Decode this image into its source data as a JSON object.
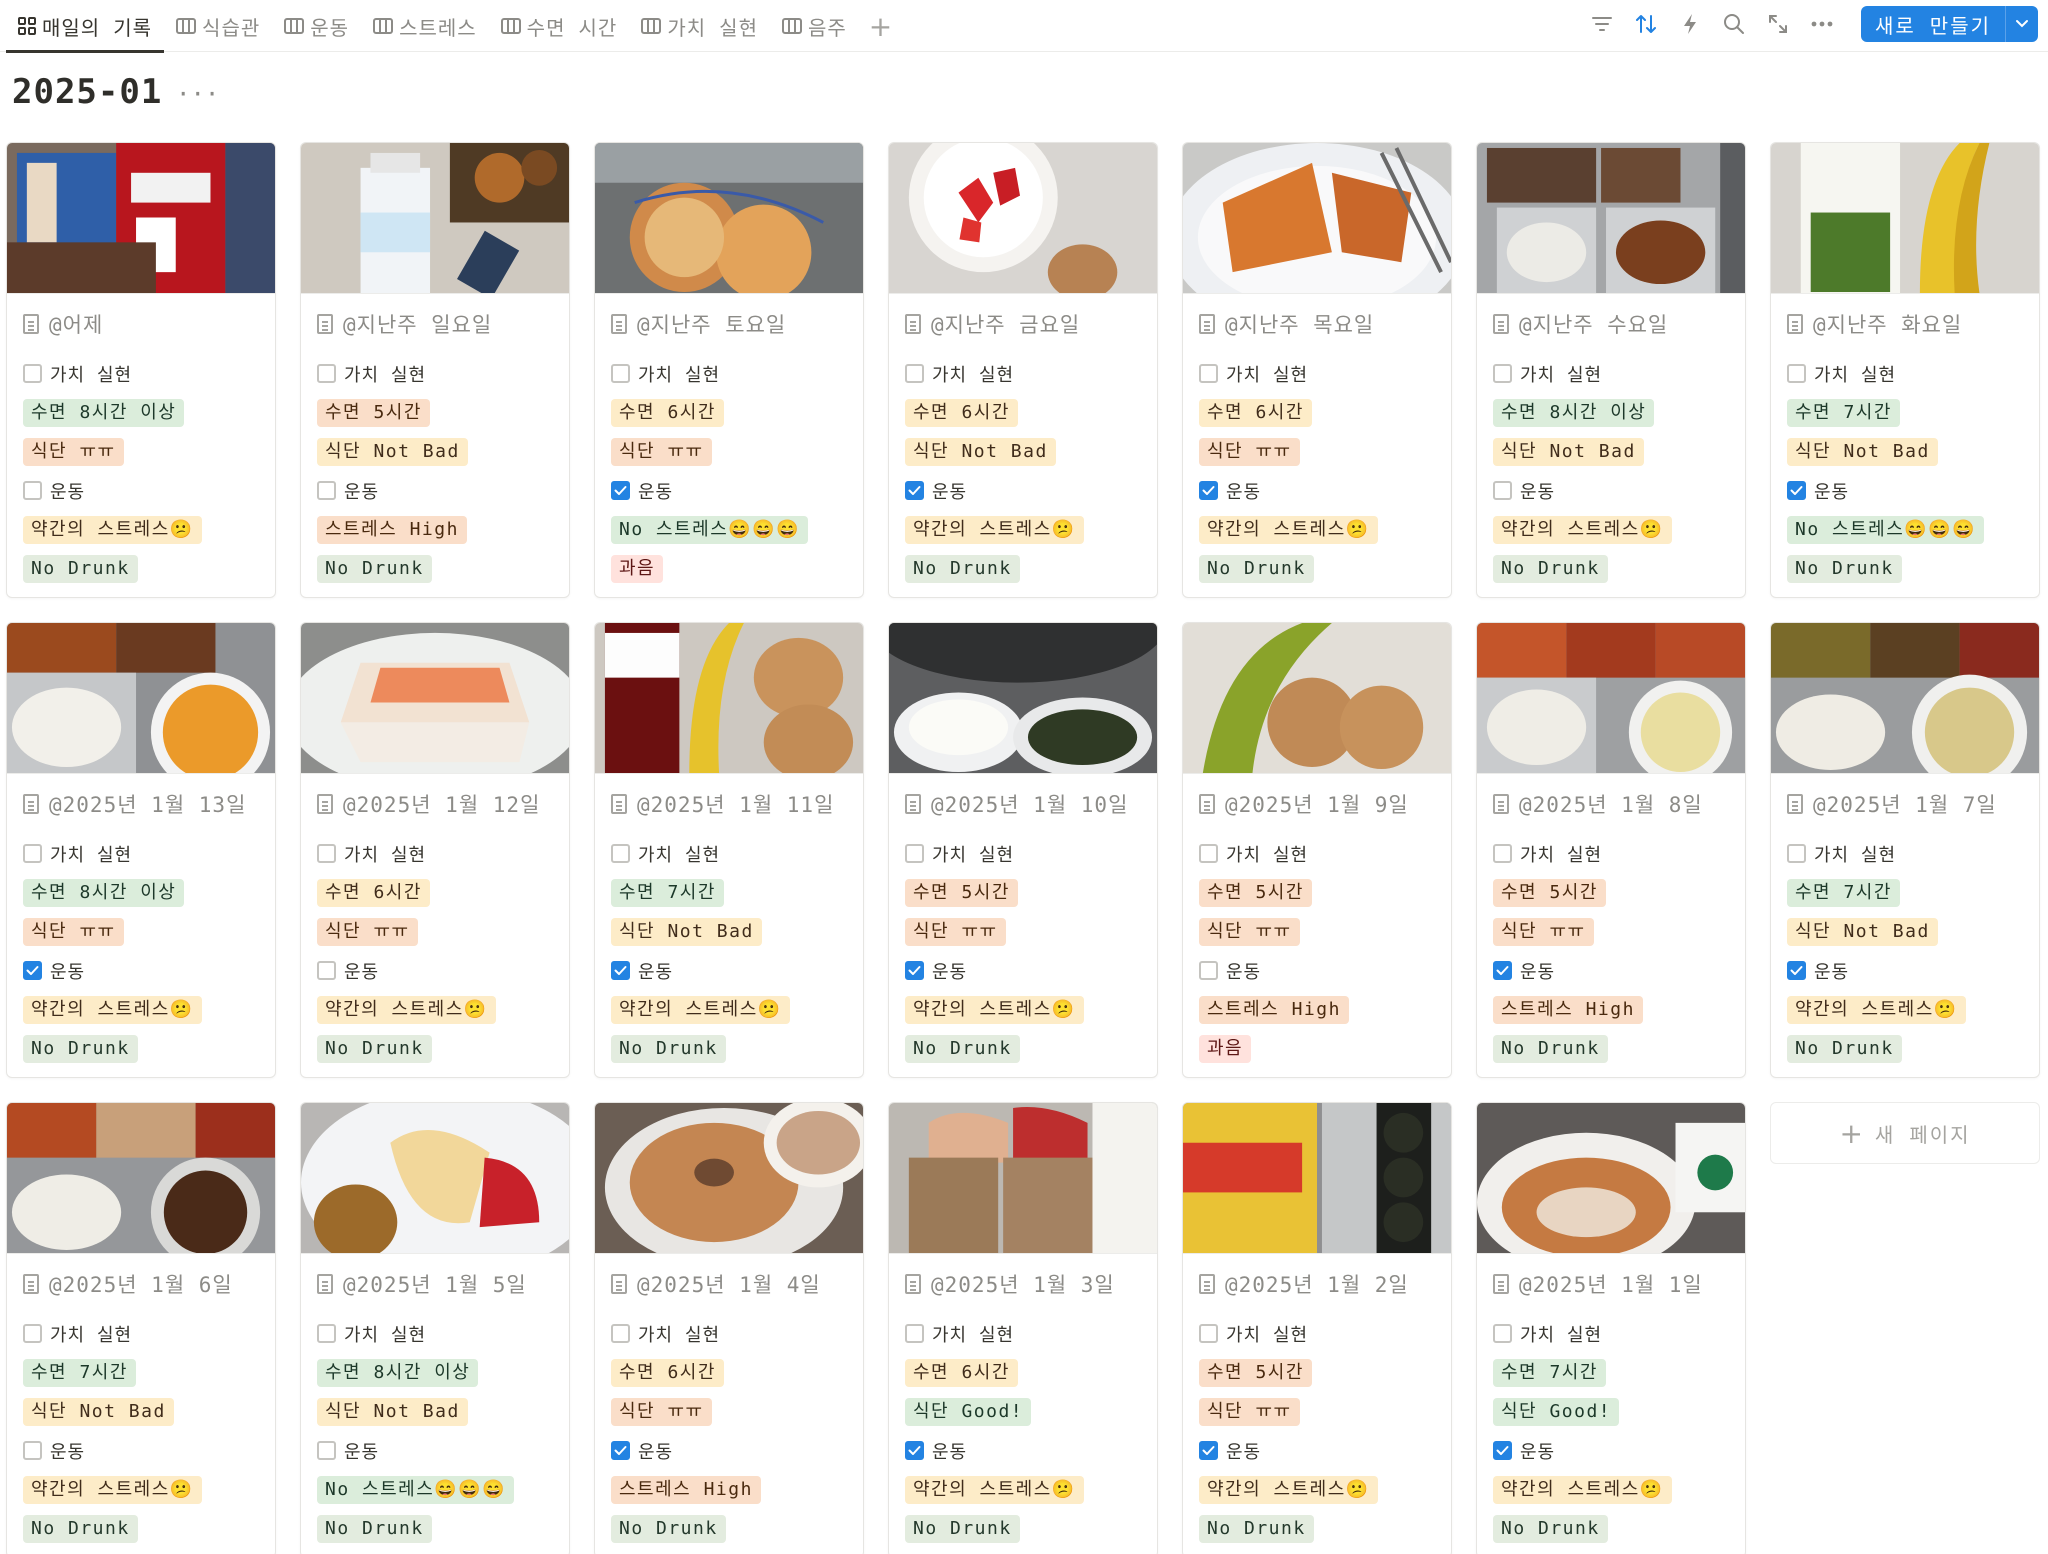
{
  "tabs": [
    {
      "label": "매일의 기록",
      "icon": "gallery-icon",
      "active": true
    },
    {
      "label": "식습관",
      "icon": "table-icon"
    },
    {
      "label": "운동",
      "icon": "table-icon"
    },
    {
      "label": "스트레스",
      "icon": "table-icon"
    },
    {
      "label": "수면 시간",
      "icon": "table-icon"
    },
    {
      "label": "가치 실현",
      "icon": "table-icon"
    },
    {
      "label": "음주",
      "icon": "table-icon"
    }
  ],
  "toolbar": {
    "add_tab": "+",
    "icons": [
      "filter-icon",
      "sort-icon",
      "automation-icon",
      "search-icon",
      "expand-icon",
      "more-icon"
    ],
    "new_button": "새로 만들기"
  },
  "page": {
    "title": "2025-01",
    "more": "···"
  },
  "colors": {
    "accent": "#2383e2"
  },
  "cards": [
    {
      "title": "@어제",
      "thumb": "dessert",
      "value": "가치 실현",
      "value_checked": false,
      "sleep": "수면 8시간 이상",
      "sleep_c": "green",
      "diet": "식단 ㅠㅠ",
      "diet_c": "orange",
      "exercise": "운동",
      "exercise_checked": false,
      "stress": "약간의 스트레스😕",
      "stress_c": "yellow",
      "drink": "No Drunk",
      "drink_c": "sage"
    },
    {
      "title": "@지난주 일요일",
      "thumb": "protein",
      "value": "가치 실현",
      "value_checked": false,
      "sleep": "수면 5시간",
      "sleep_c": "orange",
      "diet": "식단 Not Bad",
      "diet_c": "yellow",
      "exercise": "운동",
      "exercise_checked": false,
      "stress": "스트레스 High",
      "stress_c": "orange",
      "drink": "No Drunk",
      "drink_c": "sage"
    },
    {
      "title": "@지난주 토요일",
      "thumb": "cookie",
      "value": "가치 실현",
      "value_checked": false,
      "sleep": "수면 6시간",
      "sleep_c": "yellow",
      "diet": "식단 ㅠㅠ",
      "diet_c": "orange",
      "exercise": "운동",
      "exercise_checked": true,
      "stress": "No 스트레스😄😄😄",
      "stress_c": "green",
      "drink": "과음",
      "drink_c": "red"
    },
    {
      "title": "@지난주 금요일",
      "thumb": "strawberry",
      "value": "가치 실현",
      "value_checked": false,
      "sleep": "수면 6시간",
      "sleep_c": "yellow",
      "diet": "식단 Not Bad",
      "diet_c": "yellow",
      "exercise": "운동",
      "exercise_checked": true,
      "stress": "약간의 스트레스😕",
      "stress_c": "yellow",
      "drink": "No Drunk",
      "drink_c": "sage"
    },
    {
      "title": "@지난주 목요일",
      "thumb": "pancake",
      "value": "가치 실현",
      "value_checked": false,
      "sleep": "수면 6시간",
      "sleep_c": "yellow",
      "diet": "식단 ㅠㅠ",
      "diet_c": "orange",
      "exercise": "운동",
      "exercise_checked": true,
      "stress": "약간의 스트레스😕",
      "stress_c": "yellow",
      "drink": "No Drunk",
      "drink_c": "sage"
    },
    {
      "title": "@지난주 수요일",
      "thumb": "tray",
      "value": "가치 실현",
      "value_checked": false,
      "sleep": "수면 8시간 이상",
      "sleep_c": "green",
      "diet": "식단 Not Bad",
      "diet_c": "yellow",
      "exercise": "운동",
      "exercise_checked": false,
      "stress": "약간의 스트레스😕",
      "stress_c": "yellow",
      "drink": "No Drunk",
      "drink_c": "sage"
    },
    {
      "title": "@지난주 화요일",
      "thumb": "banana_milk",
      "value": "가치 실현",
      "value_checked": false,
      "sleep": "수면 7시간",
      "sleep_c": "green",
      "diet": "식단 Not Bad",
      "diet_c": "yellow",
      "exercise": "운동",
      "exercise_checked": true,
      "stress": "No 스트레스😄😄😄",
      "stress_c": "green",
      "drink": "No Drunk",
      "drink_c": "sage"
    },
    {
      "title": "@2025년 1월 13일",
      "thumb": "tray_soup",
      "value": "가치 실현",
      "value_checked": false,
      "sleep": "수면 8시간 이상",
      "sleep_c": "green",
      "diet": "식단 ㅠㅠ",
      "diet_c": "orange",
      "exercise": "운동",
      "exercise_checked": true,
      "stress": "약간의 스트레스😕",
      "stress_c": "yellow",
      "drink": "No Drunk",
      "drink_c": "sage"
    },
    {
      "title": "@2025년 1월 12일",
      "thumb": "sashimi",
      "value": "가치 실현",
      "value_checked": false,
      "sleep": "수면 6시간",
      "sleep_c": "yellow",
      "diet": "식단 ㅠㅠ",
      "diet_c": "orange",
      "exercise": "운동",
      "exercise_checked": false,
      "stress": "약간의 스트레스😕",
      "stress_c": "yellow",
      "drink": "No Drunk",
      "drink_c": "sage"
    },
    {
      "title": "@2025년 1월 11일",
      "thumb": "protein_banana",
      "value": "가치 실현",
      "value_checked": false,
      "sleep": "수면 7시간",
      "sleep_c": "green",
      "diet": "식단 Not Bad",
      "diet_c": "yellow",
      "exercise": "운동",
      "exercise_checked": true,
      "stress": "약간의 스트레스😕",
      "stress_c": "yellow",
      "drink": "No Drunk",
      "drink_c": "sage"
    },
    {
      "title": "@2025년 1월 10일",
      "thumb": "rice_soup",
      "value": "가치 실현",
      "value_checked": false,
      "sleep": "수면 5시간",
      "sleep_c": "orange",
      "diet": "식단 ㅠㅠ",
      "diet_c": "orange",
      "exercise": "운동",
      "exercise_checked": true,
      "stress": "약간의 스트레스😕",
      "stress_c": "yellow",
      "drink": "No Drunk",
      "drink_c": "sage"
    },
    {
      "title": "@2025년 1월 9일",
      "thumb": "banana_eggs",
      "value": "가치 실현",
      "value_checked": false,
      "sleep": "수면 5시간",
      "sleep_c": "orange",
      "diet": "식단 ㅠㅠ",
      "diet_c": "orange",
      "exercise": "운동",
      "exercise_checked": false,
      "stress": "스트레스 High",
      "stress_c": "orange",
      "drink": "과음",
      "drink_c": "red"
    },
    {
      "title": "@2025년 1월 8일",
      "thumb": "tray_soup2",
      "value": "가치 실현",
      "value_checked": false,
      "sleep": "수면 5시간",
      "sleep_c": "orange",
      "diet": "식단 ㅠㅠ",
      "diet_c": "orange",
      "exercise": "운동",
      "exercise_checked": true,
      "stress": "스트레스 High",
      "stress_c": "orange",
      "drink": "No Drunk",
      "drink_c": "sage"
    },
    {
      "title": "@2025년 1월 7일",
      "thumb": "tray_noodle",
      "value": "가치 실현",
      "value_checked": false,
      "sleep": "수면 7시간",
      "sleep_c": "green",
      "diet": "식단 Not Bad",
      "diet_c": "yellow",
      "exercise": "운동",
      "exercise_checked": true,
      "stress": "약간의 스트레스😕",
      "stress_c": "yellow",
      "drink": "No Drunk",
      "drink_c": "sage"
    },
    {
      "title": "@2025년 1월 6일",
      "thumb": "tray_stew",
      "value": "가치 실현",
      "value_checked": false,
      "sleep": "수면 7시간",
      "sleep_c": "green",
      "diet": "식단 Not Bad",
      "diet_c": "yellow",
      "exercise": "운동",
      "exercise_checked": false,
      "stress": "약간의 스트레스😕",
      "stress_c": "yellow",
      "drink": "No Drunk",
      "drink_c": "sage"
    },
    {
      "title": "@2025년 1월 5일",
      "thumb": "apple_egg",
      "value": "가치 실현",
      "value_checked": false,
      "sleep": "수면 8시간 이상",
      "sleep_c": "green",
      "diet": "식단 Not Bad",
      "diet_c": "yellow",
      "exercise": "운동",
      "exercise_checked": false,
      "stress": "No 스트레스😄😄😄",
      "stress_c": "green",
      "drink": "No Drunk",
      "drink_c": "sage"
    },
    {
      "title": "@2025년 1월 4일",
      "thumb": "bagel",
      "value": "가치 실현",
      "value_checked": false,
      "sleep": "수면 6시간",
      "sleep_c": "yellow",
      "diet": "식단 ㅠㅠ",
      "diet_c": "orange",
      "exercise": "운동",
      "exercise_checked": true,
      "stress": "스트레스 High",
      "stress_c": "orange",
      "drink": "No Drunk",
      "drink_c": "sage"
    },
    {
      "title": "@2025년 1월 3일",
      "thumb": "bread",
      "value": "가치 실현",
      "value_checked": false,
      "sleep": "수면 6시간",
      "sleep_c": "yellow",
      "diet": "식단 Good!",
      "diet_c": "green",
      "exercise": "운동",
      "exercise_checked": true,
      "stress": "약간의 스트레스😕",
      "stress_c": "yellow",
      "drink": "No Drunk",
      "drink_c": "sage"
    },
    {
      "title": "@2025년 1월 2일",
      "thumb": "ramen_kimbap",
      "value": "가치 실현",
      "value_checked": false,
      "sleep": "수면 5시간",
      "sleep_c": "orange",
      "diet": "식단 ㅠㅠ",
      "diet_c": "orange",
      "exercise": "운동",
      "exercise_checked": true,
      "stress": "약간의 스트레스😕",
      "stress_c": "yellow",
      "drink": "No Drunk",
      "drink_c": "sage"
    },
    {
      "title": "@2025년 1월 1일",
      "thumb": "bagel2",
      "value": "가치 실현",
      "value_checked": false,
      "sleep": "수면 7시간",
      "sleep_c": "green",
      "diet": "식단 Good!",
      "diet_c": "green",
      "exercise": "운동",
      "exercise_checked": true,
      "stress": "약간의 스트레스😕",
      "stress_c": "yellow",
      "drink": "No Drunk",
      "drink_c": "sage"
    }
  ],
  "new_page": {
    "plus": "+",
    "label": "새 페이지"
  }
}
